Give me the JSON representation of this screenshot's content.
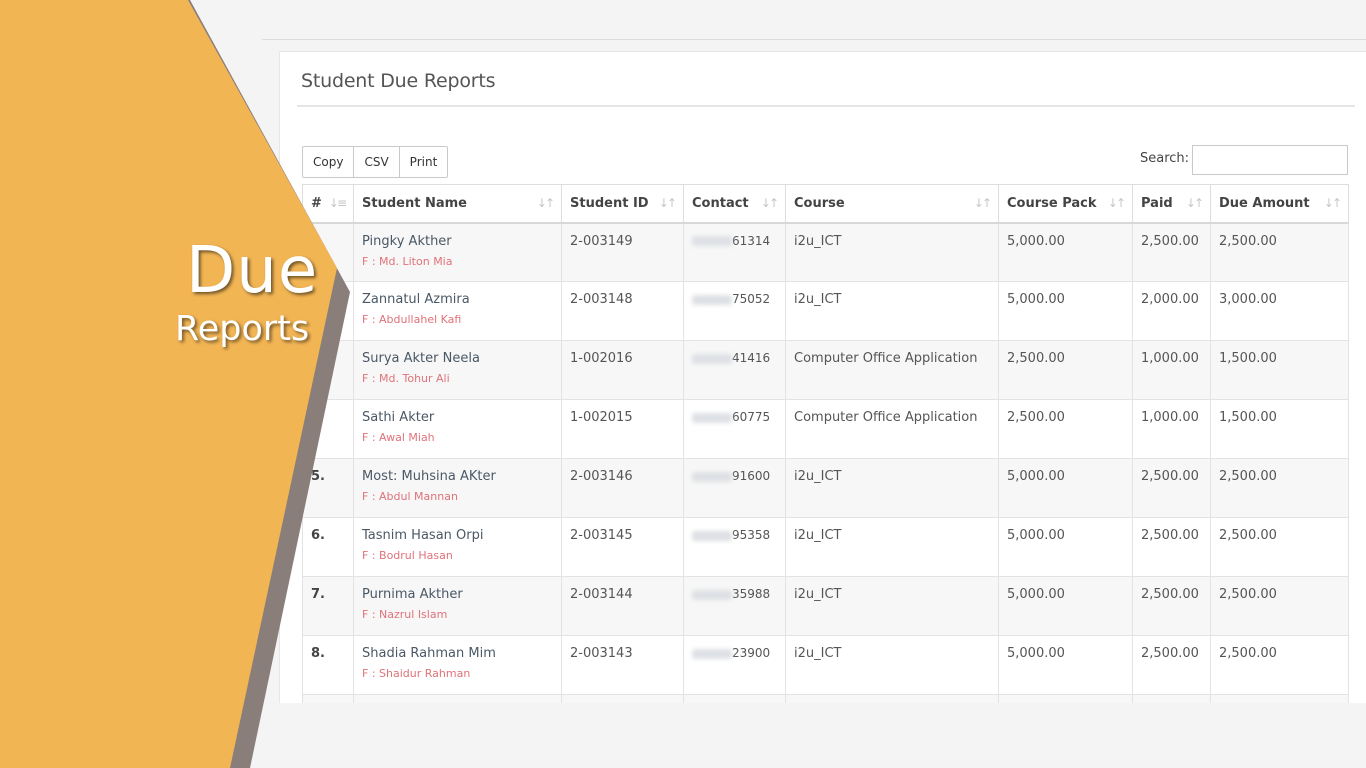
{
  "decoration": {
    "line1": "Due",
    "line2": "Reports",
    "colors": {
      "orange": "#f2b554",
      "shadow": "#8a7e7b"
    }
  },
  "panel": {
    "title": "Student Due Reports"
  },
  "toolbar": {
    "copy_label": "Copy",
    "csv_label": "CSV",
    "print_label": "Print"
  },
  "search": {
    "label": "Search:",
    "value": ""
  },
  "table": {
    "columns": [
      "#",
      "Student Name",
      "Student ID",
      "Contact",
      "Course",
      "Course Pack",
      "Paid",
      "Due Amount"
    ],
    "rows": [
      {
        "num": "",
        "name": "Pingky Akther",
        "father": "F : Md. Liton Mia",
        "id": "2-003149",
        "contact": "61314",
        "course": "i2u_ICT",
        "pack": "5,000.00",
        "paid": "2,500.00",
        "due": "2,500.00"
      },
      {
        "num": "",
        "name": "Zannatul Azmira",
        "father": "F : Abdullahel Kafi",
        "id": "2-003148",
        "contact": "75052",
        "course": "i2u_ICT",
        "pack": "5,000.00",
        "paid": "2,000.00",
        "due": "3,000.00"
      },
      {
        "num": "",
        "name": "Surya Akter Neela",
        "father": "F : Md. Tohur Ali",
        "id": "1-002016",
        "contact": "41416",
        "course": "Computer Office Application",
        "pack": "2,500.00",
        "paid": "1,000.00",
        "due": "1,500.00"
      },
      {
        "num": "",
        "name": "Sathi Akter",
        "father": "F : Awal Miah",
        "id": "1-002015",
        "contact": "60775",
        "course": "Computer Office Application",
        "pack": "2,500.00",
        "paid": "1,000.00",
        "due": "1,500.00"
      },
      {
        "num": "5.",
        "name": "Most: Muhsina AKter",
        "father": "F : Abdul Mannan",
        "id": "2-003146",
        "contact": "91600",
        "course": "i2u_ICT",
        "pack": "5,000.00",
        "paid": "2,500.00",
        "due": "2,500.00"
      },
      {
        "num": "6.",
        "name": "Tasnim Hasan Orpi",
        "father": "F : Bodrul Hasan",
        "id": "2-003145",
        "contact": "95358",
        "course": "i2u_ICT",
        "pack": "5,000.00",
        "paid": "2,500.00",
        "due": "2,500.00"
      },
      {
        "num": "7.",
        "name": "Purnima Akther",
        "father": "F : Nazrul Islam",
        "id": "2-003144",
        "contact": "35988",
        "course": "i2u_ICT",
        "pack": "5,000.00",
        "paid": "2,500.00",
        "due": "2,500.00"
      },
      {
        "num": "8.",
        "name": "Shadia Rahman Mim",
        "father": "F : Shaidur Rahman",
        "id": "2-003143",
        "contact": "23900",
        "course": "i2u_ICT",
        "pack": "5,000.00",
        "paid": "2,500.00",
        "due": "2,500.00"
      }
    ]
  }
}
